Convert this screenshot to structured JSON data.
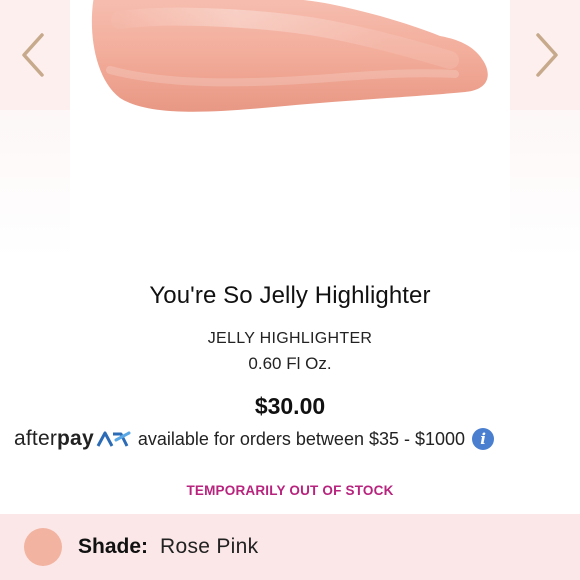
{
  "gallery": {
    "prev_icon": "chevron-left-icon",
    "next_icon": "chevron-right-icon",
    "image_alt": "Rose Pink highlighter swatch"
  },
  "product": {
    "name": "You're So Jelly Highlighter",
    "type": "JELLY HIGHLIGHTER",
    "size": "0.60 Fl Oz.",
    "price": "$30.00"
  },
  "afterpay": {
    "logo_light": "after",
    "logo_bold": "pay",
    "message": "available for orders between $35 - $1000",
    "info_icon": "info-icon"
  },
  "stock_status": "TEMPORARILY OUT OF STOCK",
  "shade": {
    "label": "Shade:",
    "value": "Rose Pink"
  },
  "colors": {
    "panel_tint": "#fcefee",
    "chevron": "#c7a98b",
    "swatch": "#f2b3a1",
    "stock_text": "#b8237e",
    "info_blue": "#4a7fd0",
    "shade_bar": "#fbe7e7"
  }
}
